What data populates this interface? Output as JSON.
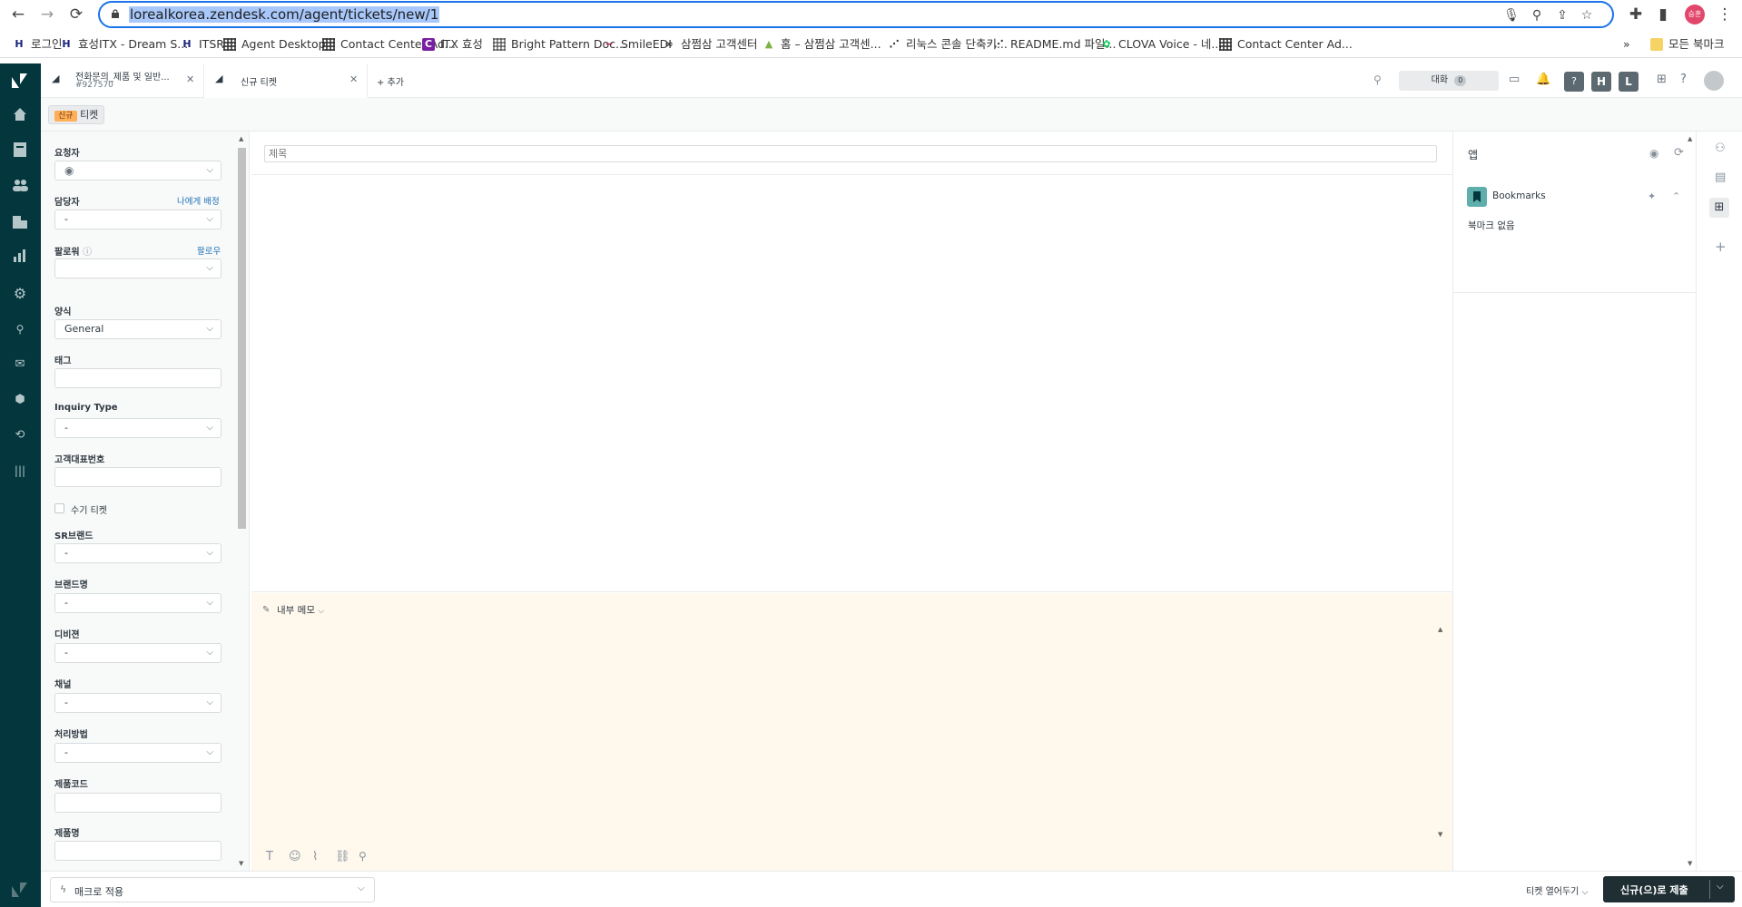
{
  "browser": {
    "url": "lorealkorea.zendesk.com/agent/tickets/new/1",
    "profile_initials": "승훈"
  },
  "bookmarks": [
    {
      "label": "로그인",
      "icon": "H",
      "color": "#1a237e"
    },
    {
      "label": "효성ITX - Dream S...",
      "icon": "H",
      "color": "#1a237e"
    },
    {
      "label": "ITSR",
      "icon": "H",
      "color": "#1a237e"
    },
    {
      "label": "Agent Desktop",
      "icon": "grid",
      "color": "#333333"
    },
    {
      "label": "Contact Center Ad...",
      "icon": "grid",
      "color": "#333333"
    },
    {
      "label": "ITX 효성",
      "icon": "C",
      "color": "#7b1fa2"
    },
    {
      "label": "Bright Pattern Doc...",
      "icon": "grid",
      "color": "#777777"
    },
    {
      "label": "SmileEDI",
      "icon": "~",
      "color": "#c2185b"
    },
    {
      "label": "삼쩜삼 고객센터",
      "icon": "∞",
      "color": "#333333"
    },
    {
      "label": "홈 – 삼쩜삼 고객센...",
      "icon": "▲",
      "color": "#7cb342"
    },
    {
      "label": "리눅스 콘솔 단축키...",
      "icon": "⋰",
      "color": "#333333"
    },
    {
      "label": "README.md 파일...",
      "icon": "⋰",
      "color": "#333333"
    },
    {
      "label": "CLOVA Voice - 네...",
      "icon": "✿",
      "color": "#00c853"
    },
    {
      "label": "Contact Center Ad...",
      "icon": "grid",
      "color": "#333333"
    }
  ],
  "bookmarks_more": "»",
  "bookmarks_all": "모든 북마크",
  "tabs": [
    {
      "title": "전화문의_제품 및 일반...",
      "subtitle": "#927570"
    },
    {
      "title": "신규 티켓",
      "subtitle": ""
    }
  ],
  "add_tab": "+ 추가",
  "conversations": {
    "label": "대화",
    "count": "0"
  },
  "header_avatars": [
    "H",
    "L"
  ],
  "status_badge": "신규",
  "ticket_label": "티켓",
  "fields": {
    "requester": {
      "label": "요청자"
    },
    "assignee": {
      "label": "담당자",
      "value": "-",
      "link": "나에게 배정"
    },
    "followers": {
      "label": "팔로워",
      "link": "팔로우"
    },
    "form": {
      "label": "양식",
      "value": "General"
    },
    "tags": {
      "label": "태그"
    },
    "inquiry_type": {
      "label": "Inquiry Type",
      "value": "-"
    },
    "customer_phone": {
      "label": "고객대표번호"
    },
    "manual_ticket": {
      "label": "수기 티켓"
    },
    "sr_brand": {
      "label": "SR브랜드",
      "value": "-"
    },
    "brand_name": {
      "label": "브랜드명",
      "value": "-"
    },
    "division": {
      "label": "디비젼",
      "value": "-"
    },
    "channel": {
      "label": "채널",
      "value": "-"
    },
    "process": {
      "label": "처리방법",
      "value": "-"
    },
    "product_code": {
      "label": "제품코드"
    },
    "product_name": {
      "label": "제품명"
    }
  },
  "subject_placeholder": "제목",
  "memo": {
    "label": "내부 메모"
  },
  "apps": {
    "title": "앱",
    "bookmarks_title": "Bookmarks",
    "empty": "북마크 없음"
  },
  "footer": {
    "macro": "매크로 적용",
    "close_tab": "티켓 열어두기",
    "submit": "신규(으)로 제출"
  },
  "colors": {
    "nav_bg": "#03363d",
    "submit_bg": "#1f2e33",
    "badge_bg": "#ffb057",
    "memo_bg": "#fff8ed",
    "link": "#1f73b7"
  }
}
